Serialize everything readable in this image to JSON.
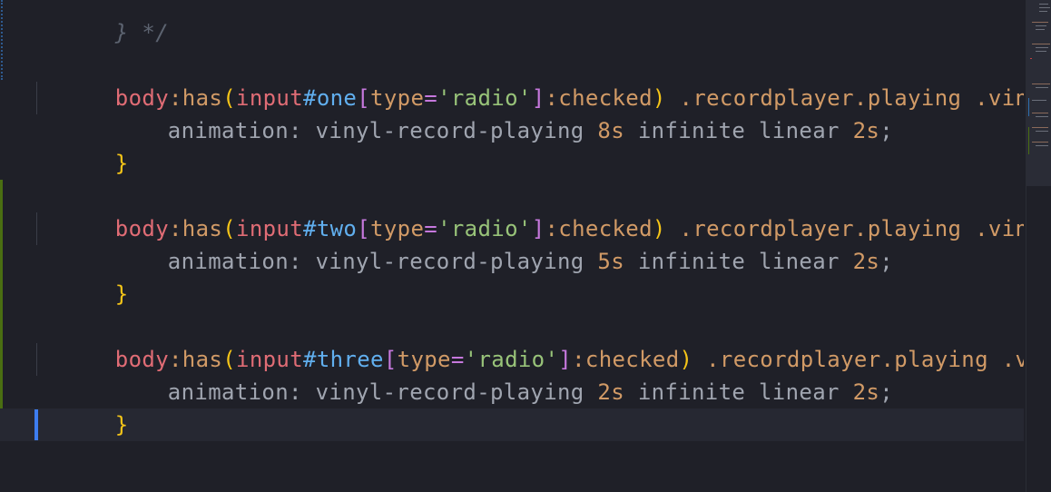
{
  "editor": {
    "top_partial_comment": "} */",
    "blocks": [
      {
        "selector": {
          "body": "body",
          "pseudo_has": ":has",
          "open_paren": "(",
          "input_tag": "input",
          "hash": "#",
          "id": "one",
          "open_bracket": "[",
          "attr": "type",
          "eq": "=",
          "quote_open": "'",
          "str": "radio",
          "quote_close": "'",
          "close_bracket": "]",
          "pseudo_checked": ":checked",
          "close_paren": ")",
          "class1": " .recordplayer.playing",
          "class2": " .vinyl",
          "open_brace": " {"
        },
        "property": "animation",
        "colon": ": ",
        "value_name": "vinyl-record-playing ",
        "duration": "8s",
        "value_rest": " infinite linear ",
        "delay": "2s",
        "semicolon": ";",
        "close_brace": "}"
      },
      {
        "selector": {
          "body": "body",
          "pseudo_has": ":has",
          "open_paren": "(",
          "input_tag": "input",
          "hash": "#",
          "id": "two",
          "open_bracket": "[",
          "attr": "type",
          "eq": "=",
          "quote_open": "'",
          "str": "radio",
          "quote_close": "'",
          "close_bracket": "]",
          "pseudo_checked": ":checked",
          "close_paren": ")",
          "class1": " .recordplayer.playing",
          "class2": " .vinyl",
          "open_brace": " {"
        },
        "property": "animation",
        "colon": ": ",
        "value_name": "vinyl-record-playing ",
        "duration": "5s",
        "value_rest": " infinite linear ",
        "delay": "2s",
        "semicolon": ";",
        "close_brace": "}"
      },
      {
        "selector": {
          "body": "body",
          "pseudo_has": ":has",
          "open_paren": "(",
          "input_tag": "input",
          "hash": "#",
          "id": "three",
          "open_bracket": "[",
          "attr": "type",
          "eq": "=",
          "quote_open": "'",
          "str": "radio",
          "quote_close": "'",
          "close_bracket": "]",
          "pseudo_checked": ":checked",
          "close_paren": ")",
          "class1": " .recordplayer.playing",
          "class2": " .vinyl",
          "open_brace": " {"
        },
        "property": "animation",
        "colon": ": ",
        "value_name": "vinyl-record-playing ",
        "duration": "2s",
        "value_rest": " infinite linear ",
        "delay": "2s",
        "semicolon": ";",
        "close_brace": "}"
      }
    ]
  },
  "colors": {
    "background": "#1f2028",
    "selector": "#e06c75",
    "id": "#61afef",
    "bracket": "#c678dd",
    "string": "#98c379",
    "class": "#d19a66",
    "brace": "#f5c518",
    "cursor": "#3d7df0",
    "git_added": "#4a6e12"
  }
}
